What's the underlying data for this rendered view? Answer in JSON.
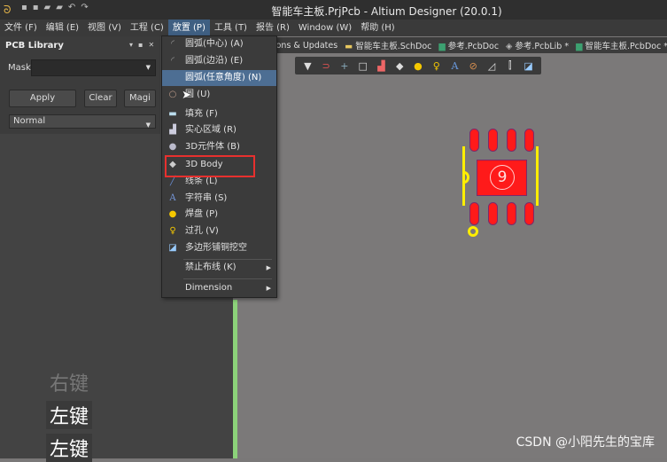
{
  "title": "智能车主板.PrjPcb - Altium Designer (20.0.1)",
  "menubar": [
    "文件 (F)",
    "编辑 (E)",
    "视图 (V)",
    "工程 (C)",
    "放置 (P)",
    "工具 (T)",
    "报告 (R)",
    "Window (W)",
    "帮助 (H)"
  ],
  "panel": {
    "title": "PCB Library",
    "mask_label": "Mask",
    "mask_value": "",
    "apply": "Apply",
    "clear": "Clear",
    "magnify": "Magi",
    "mode": "Normal"
  },
  "tabs": [
    "nsions & Updates",
    "智能车主板.SchDoc",
    "参考.PcbDoc",
    "参考.PcbLib *",
    "智能车主板.PcbDoc *"
  ],
  "menu": {
    "items": [
      {
        "label": "圆弧(中心) (A)",
        "icon": "arc-center-icon"
      },
      {
        "label": "圆弧(边沿) (E)",
        "icon": "arc-edge-icon"
      },
      {
        "label": "圆弧(任意角度) (N)",
        "icon": "arc-any-icon"
      },
      {
        "label": "圆 (U)",
        "icon": "circle-icon"
      },
      {
        "label": "填充 (F)",
        "icon": "fill-icon"
      },
      {
        "label": "实心区域 (R)",
        "icon": "solid-region-icon"
      },
      {
        "label": "3D元件体 (B)",
        "icon": "3d-body-icon"
      },
      {
        "label": "3D Body",
        "icon": "3d-body-icon"
      },
      {
        "label": "线条 (L)",
        "icon": "line-icon"
      },
      {
        "label": "字符串 (S)",
        "icon": "string-icon"
      },
      {
        "label": "焊盘 (P)",
        "icon": "pad-icon"
      },
      {
        "label": "过孔 (V)",
        "icon": "via-icon"
      },
      {
        "label": "多边形铺铜挖空",
        "icon": "polygon-cutout-icon"
      },
      {
        "label": "禁止布线 (K)",
        "icon": ""
      },
      {
        "label": "Dimension",
        "icon": ""
      }
    ],
    "highlighted": "圆弧(任意角度) (N)",
    "boxed": "3D Body"
  },
  "component": {
    "designator": "9",
    "pad_color": "#ff1a1a",
    "outline_color": "#ffee00"
  },
  "keys": [
    "右键",
    "左键",
    "左键"
  ],
  "watermark": "CSDN @小阳先生的宝库"
}
